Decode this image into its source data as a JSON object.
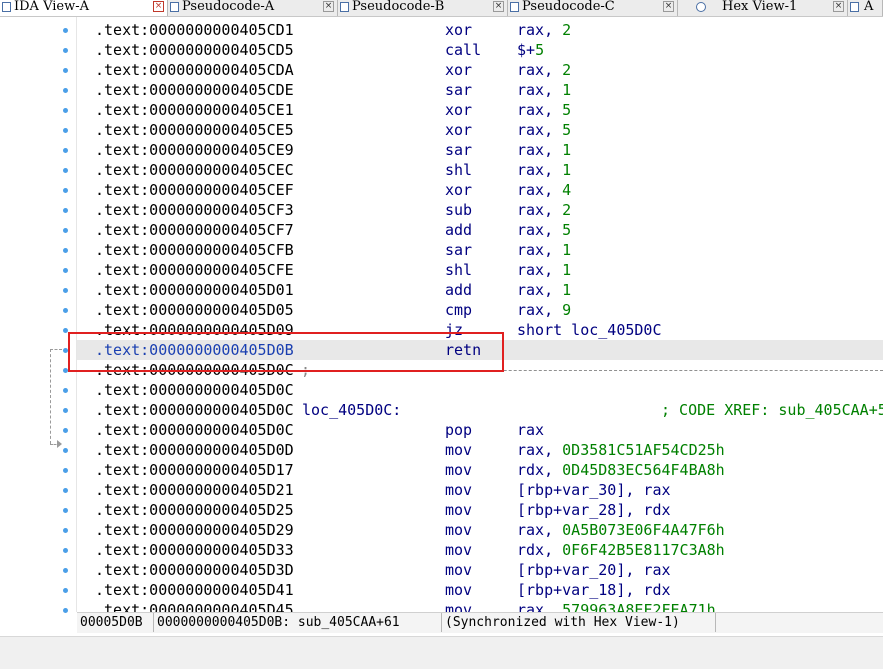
{
  "tabs": [
    {
      "label": "IDA View-A",
      "active": true,
      "icon": "ida-view-icon"
    },
    {
      "label": "Pseudocode-A",
      "active": false,
      "icon": "pseudocode-icon"
    },
    {
      "label": "Pseudocode-B",
      "active": false,
      "icon": "pseudocode-icon"
    },
    {
      "label": "Pseudocode-C",
      "active": false,
      "icon": "pseudocode-icon"
    },
    {
      "label": "Hex View-1",
      "active": false,
      "icon": "hex-view-icon"
    },
    {
      "label": "A",
      "active": false,
      "icon": "structures-icon"
    }
  ],
  "close_glyph": "×",
  "listing": [
    {
      "addr": ".text:0000000000405CD1",
      "mnem": "xor",
      "ops": [
        "rax, ",
        "2"
      ]
    },
    {
      "addr": ".text:0000000000405CD5",
      "mnem": "call",
      "ops": [
        "$+",
        "5"
      ]
    },
    {
      "addr": ".text:0000000000405CDA",
      "mnem": "xor",
      "ops": [
        "rax, ",
        "2"
      ]
    },
    {
      "addr": ".text:0000000000405CDE",
      "mnem": "sar",
      "ops": [
        "rax, ",
        "1"
      ]
    },
    {
      "addr": ".text:0000000000405CE1",
      "mnem": "xor",
      "ops": [
        "rax, ",
        "5"
      ]
    },
    {
      "addr": ".text:0000000000405CE5",
      "mnem": "xor",
      "ops": [
        "rax, ",
        "5"
      ]
    },
    {
      "addr": ".text:0000000000405CE9",
      "mnem": "sar",
      "ops": [
        "rax, ",
        "1"
      ]
    },
    {
      "addr": ".text:0000000000405CEC",
      "mnem": "shl",
      "ops": [
        "rax, ",
        "1"
      ]
    },
    {
      "addr": ".text:0000000000405CEF",
      "mnem": "xor",
      "ops": [
        "rax, ",
        "4"
      ]
    },
    {
      "addr": ".text:0000000000405CF3",
      "mnem": "sub",
      "ops": [
        "rax, ",
        "2"
      ]
    },
    {
      "addr": ".text:0000000000405CF7",
      "mnem": "add",
      "ops": [
        "rax, ",
        "5"
      ]
    },
    {
      "addr": ".text:0000000000405CFB",
      "mnem": "sar",
      "ops": [
        "rax, ",
        "1"
      ]
    },
    {
      "addr": ".text:0000000000405CFE",
      "mnem": "shl",
      "ops": [
        "rax, ",
        "1"
      ]
    },
    {
      "addr": ".text:0000000000405D01",
      "mnem": "add",
      "ops": [
        "rax, ",
        "1"
      ]
    },
    {
      "addr": ".text:0000000000405D05",
      "mnem": "cmp",
      "ops": [
        "rax, ",
        "9"
      ]
    },
    {
      "addr": ".text:0000000000405D09",
      "mnem": "jz",
      "ops": [
        "short loc_405D0C",
        ""
      ]
    },
    {
      "addr": ".text:0000000000405D0B",
      "mnem": "retn",
      "ops": [
        "",
        ""
      ],
      "highlight": true
    },
    {
      "addr": ".text:0000000000405D0C",
      "separator": ";"
    },
    {
      "addr": ".text:0000000000405D0C"
    },
    {
      "addr": ".text:0000000000405D0C",
      "label": "loc_405D0C:",
      "comment": "; CODE XREF: sub_405CAA+5"
    },
    {
      "addr": ".text:0000000000405D0C",
      "mnem": "pop",
      "ops": [
        "rax",
        ""
      ]
    },
    {
      "addr": ".text:0000000000405D0D",
      "mnem": "mov",
      "ops": [
        "rax, ",
        "0D3581C51AF54CD25h"
      ]
    },
    {
      "addr": ".text:0000000000405D17",
      "mnem": "mov",
      "ops": [
        "rdx, ",
        "0D45D83EC564F4BA8h"
      ]
    },
    {
      "addr": ".text:0000000000405D21",
      "mnem": "mov",
      "ops": [
        "[rbp+var_30], rax",
        ""
      ]
    },
    {
      "addr": ".text:0000000000405D25",
      "mnem": "mov",
      "ops": [
        "[rbp+var_28], rdx",
        ""
      ]
    },
    {
      "addr": ".text:0000000000405D29",
      "mnem": "mov",
      "ops": [
        "rax, ",
        "0A5B073E06F4A47F6h"
      ]
    },
    {
      "addr": ".text:0000000000405D33",
      "mnem": "mov",
      "ops": [
        "rdx, ",
        "0F6F42B5E8117C3A8h"
      ]
    },
    {
      "addr": ".text:0000000000405D3D",
      "mnem": "mov",
      "ops": [
        "[rbp+var_20], rax",
        ""
      ]
    },
    {
      "addr": ".text:0000000000405D41",
      "mnem": "mov",
      "ops": [
        "[rbp+var_18], rdx",
        ""
      ]
    },
    {
      "addr": ".text:0000000000405D45",
      "mnem": "mov",
      "ops": [
        "rax, ",
        "579963A8EF2FEA71h"
      ]
    }
  ],
  "status": {
    "offset": "00005D0B",
    "location": "0000000000405D0B: sub_405CAA+61",
    "sync": "(Synchronized with Hex View-1)"
  },
  "colors": {
    "mnemonic": "#000080",
    "number": "#008000",
    "highlight_box": "#e02020",
    "breakpoint_dot": "#4a9fe8"
  }
}
